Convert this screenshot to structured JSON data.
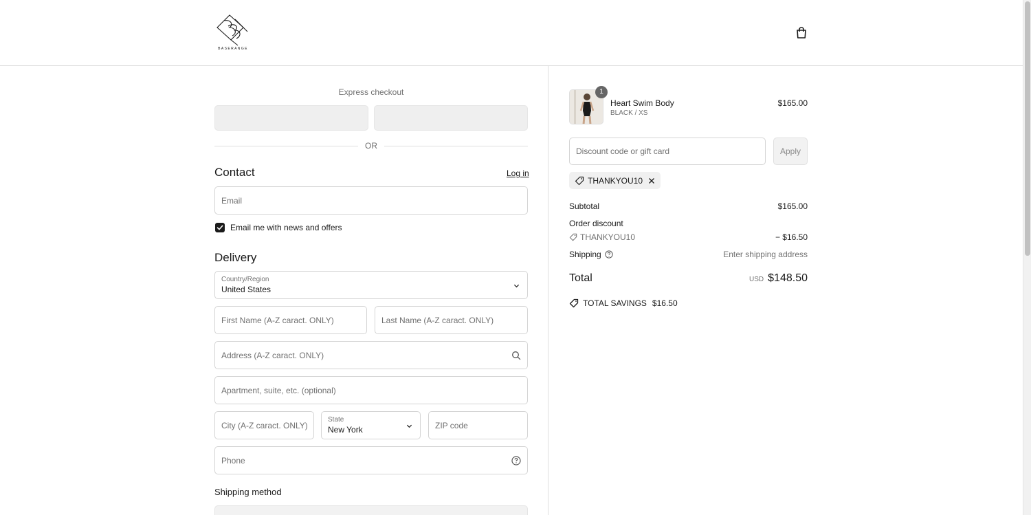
{
  "header": {
    "logo_text": "BASERANGE",
    "cart_icon": "shopping-bag-icon"
  },
  "express": {
    "title": "Express checkout",
    "divider_text": "OR"
  },
  "contact": {
    "heading": "Contact",
    "login_label": "Log in",
    "email_placeholder": "Email",
    "newsletter_label": "Email me with news and offers",
    "newsletter_checked": true
  },
  "delivery": {
    "heading": "Delivery",
    "country_label": "Country/Region",
    "country_value": "United States",
    "first_name_placeholder": "First Name (A-Z caract. ONLY)",
    "last_name_placeholder": "Last Name (A-Z caract. ONLY)",
    "address_placeholder": "Address (A-Z caract. ONLY)",
    "apartment_placeholder": "Apartment, suite, etc. (optional)",
    "city_placeholder": "City (A-Z caract. ONLY)",
    "state_label": "State",
    "state_value": "New York",
    "zip_placeholder": "ZIP code",
    "phone_placeholder": "Phone"
  },
  "shipping_method": {
    "heading": "Shipping method"
  },
  "summary": {
    "item": {
      "name": "Heart Swim Body",
      "variant": "BLACK / XS",
      "price": "$165.00",
      "quantity": "1"
    },
    "discount_placeholder": "Discount code or gift card",
    "apply_label": "Apply",
    "applied_code": "THANKYOU10",
    "subtotal_label": "Subtotal",
    "subtotal_value": "$165.00",
    "order_discount_label": "Order discount",
    "order_discount_code": "THANKYOU10",
    "order_discount_value": "− $16.50",
    "shipping_label": "Shipping",
    "shipping_value": "Enter shipping address",
    "total_label": "Total",
    "total_currency": "USD",
    "total_value": "$148.50",
    "savings_label": "TOTAL SAVINGS",
    "savings_value": "$16.50"
  },
  "colors": {
    "text": "#1a1a1a",
    "muted": "#707070",
    "border": "#d4d4d4",
    "checkbox": "#1a1a1a"
  }
}
